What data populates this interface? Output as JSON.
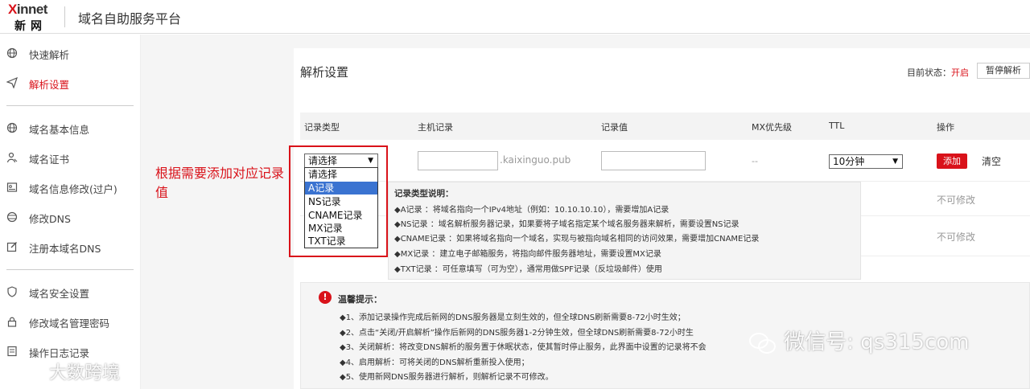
{
  "header": {
    "logo_brand": "Xinnet",
    "logo_cn": "新网",
    "title": "域名自助服务平台"
  },
  "sidebar": {
    "items": [
      {
        "label": "快速解析",
        "icon": "globe-icon"
      },
      {
        "label": "解析设置",
        "icon": "send-icon",
        "active": true
      },
      {
        "label": "域名基本信息",
        "icon": "globe-icon"
      },
      {
        "label": "域名证书",
        "icon": "user-certificate-icon"
      },
      {
        "label": "域名信息修改(过户)",
        "icon": "id-card-icon"
      },
      {
        "label": "修改DNS",
        "icon": "dns-icon"
      },
      {
        "label": "注册本域名DNS",
        "icon": "edit-icon"
      },
      {
        "label": "域名安全设置",
        "icon": "shield-icon"
      },
      {
        "label": "修改域名管理密码",
        "icon": "lock-icon"
      },
      {
        "label": "操作日志记录",
        "icon": "log-icon"
      }
    ]
  },
  "main": {
    "title": "解析设置",
    "status_label": "目前状态：",
    "status_value": "开启",
    "pause_button": "暂停解析",
    "columns": [
      "记录类型",
      "主机记录",
      "记录值",
      "MX优先级",
      "TTL",
      "操作"
    ],
    "row": {
      "type_select": "请选择",
      "host_suffix": ".kaixinguo.pub",
      "mx_priority": "--",
      "ttl_select": "10分钟",
      "add_button": "添加",
      "clear_button": "清空"
    },
    "readonly_text": "不可修改",
    "type_options": [
      "请选择",
      "A记录",
      "NS记录",
      "CNAME记录",
      "MX记录",
      "TXT记录"
    ],
    "type_options_highlighted": "A记录"
  },
  "annotation": {
    "text": "根据需要添加对应记录值",
    "color": "#d9121a"
  },
  "tooltip": {
    "title": "记录类型说明：",
    "lines": [
      "◆A记录 ：将域名指向一个IPv4地址（例如：10.10.10.10），需要增加A记录",
      "◆NS记录 ：域名解析服务器记录，如果要将子域名指定某个域名服务器来解析，需要设置NS记录",
      "◆CNAME记录 ：如果将域名指向一个域名，实现与被指向域名相同的访问效果，需要增加CNAME记录",
      "◆MX记录 ：建立电子邮箱服务，将指向邮件服务器地址，需要设置MX记录",
      "◆TXT记录 ：可任意填写（可为空），通常用做SPF记录（反垃圾邮件）使用"
    ]
  },
  "warm_tips": {
    "title": "温馨提示：",
    "lines": [
      "◆1、添加记录操作完成后新网的DNS服务器是立刻生效的，但全球DNS刷新需要8-72小时生效；",
      "◆2、点击“关闭/开启解析”操作后新网的DNS服务器1-2分钟生效，但全球DNS刷新需要8-72小时生",
      "◆3、关闭解析：将改变DNS解析的服务置于休眠状态，使其暂时停止服务，此界面中设置的记录将不会",
      "◆4、启用解析：可将关闭的DNS解析重新投入使用；",
      "◆5、使用新网DNS服务器进行解析，则解析记录不可修改。"
    ]
  },
  "watermarks": {
    "wechat": "微信号: qs315com",
    "bottom_left": "大数跨境"
  },
  "colors": {
    "accent": "#d9121a",
    "highlight": "#3a73d1"
  }
}
